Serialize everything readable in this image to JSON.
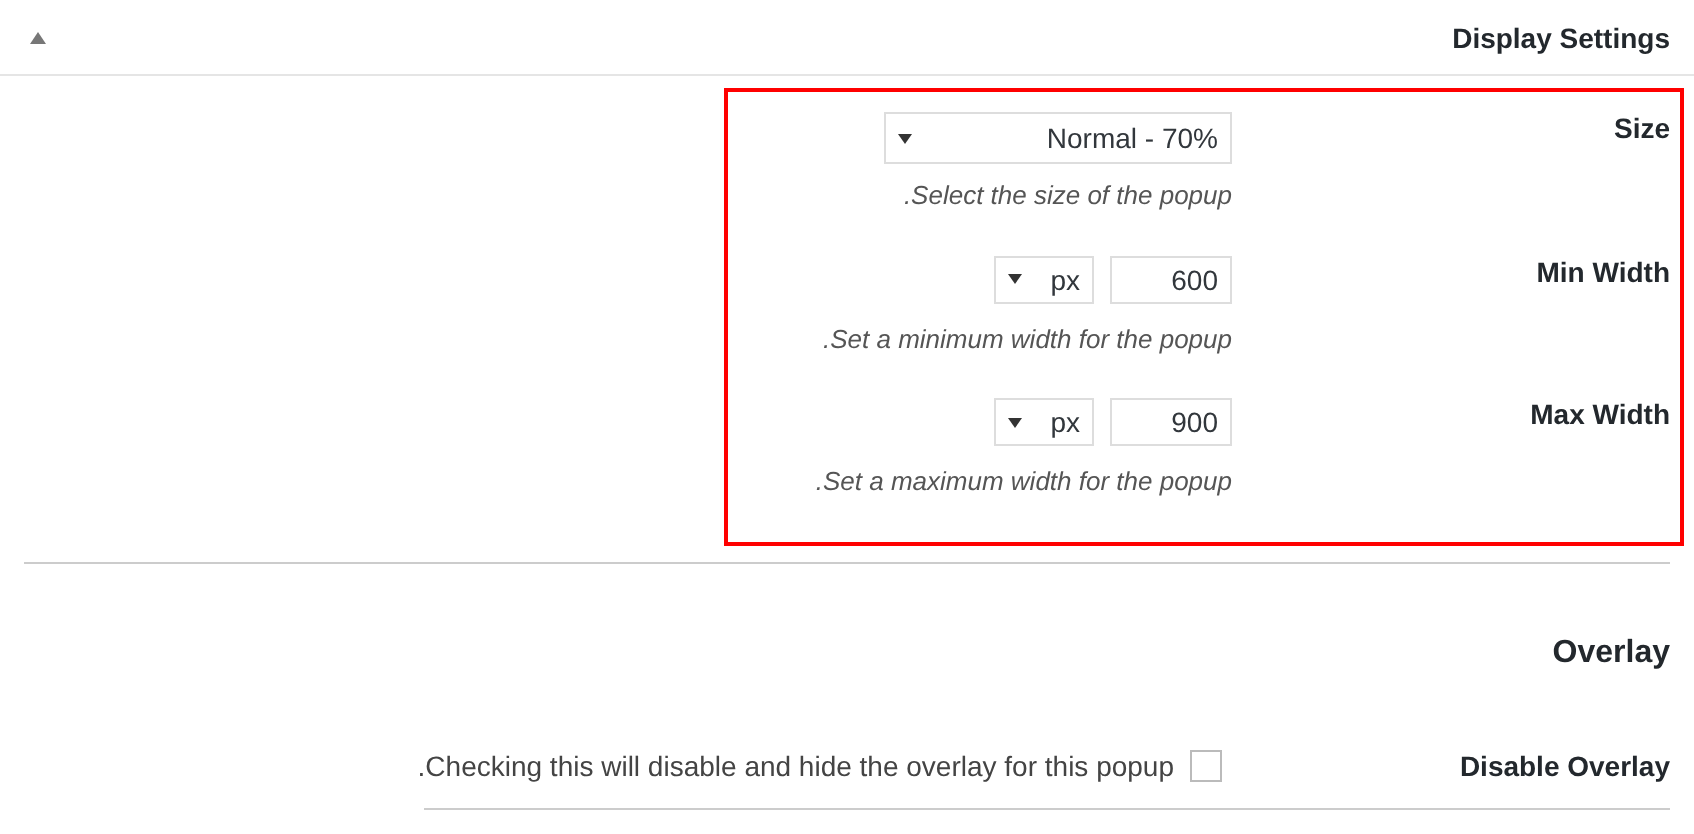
{
  "header": {
    "title": "Display Settings"
  },
  "highlighted_fields": [
    {
      "kind": "select",
      "label": "Size",
      "value": "Normal - 70%",
      "description": ".Select the size of the popup"
    },
    {
      "kind": "number_unit",
      "label": "Min Width",
      "unit": "px",
      "value": "600",
      "description": ".Set a minimum width for the popup"
    },
    {
      "kind": "number_unit",
      "label": "Max Width",
      "unit": "px",
      "value": "900",
      "description": ".Set a maximum width for the popup"
    }
  ],
  "overlay": {
    "heading": "Overlay",
    "fields": [
      {
        "kind": "checkbox",
        "label": "Disable Overlay",
        "checked": false,
        "description": ".Checking this will disable and hide the overlay for this popup"
      }
    ]
  }
}
